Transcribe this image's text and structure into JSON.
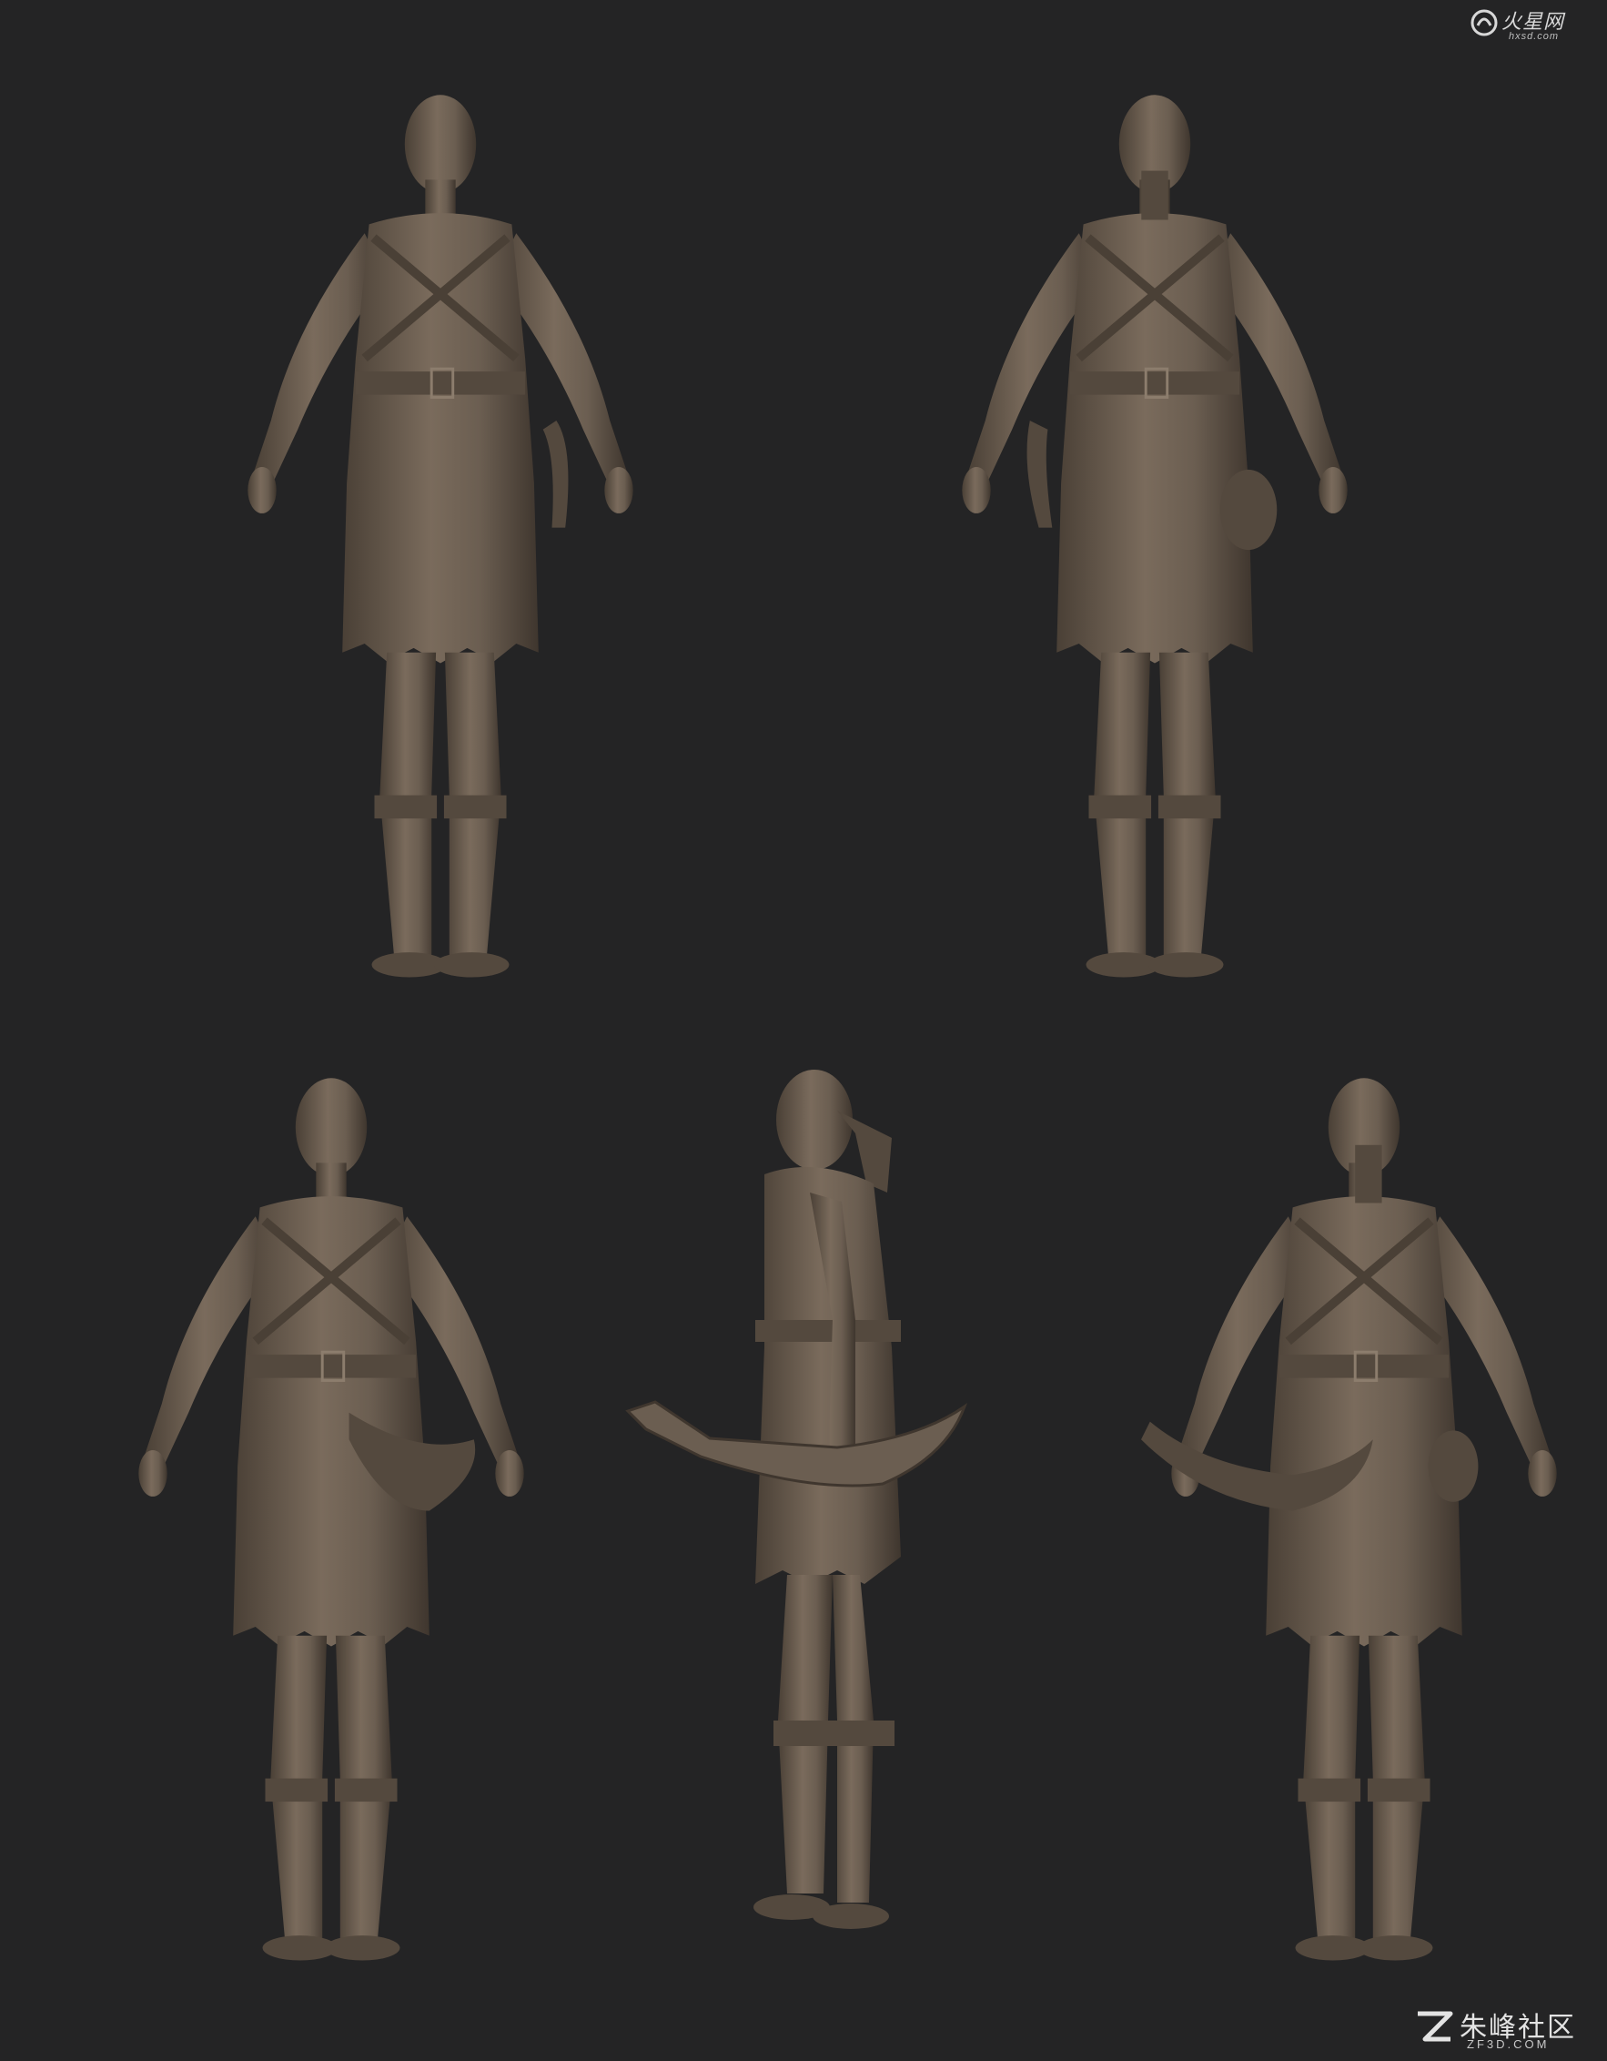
{
  "scene": {
    "background": "#242425",
    "sculpt_color": "#6b5e51",
    "sculpt_highlight": "#8c7d6d",
    "sculpt_shadow": "#3f362e",
    "views": [
      {
        "name": "front view",
        "icon": "figure-front"
      },
      {
        "name": "back view",
        "icon": "figure-back"
      },
      {
        "name": "three-quarter front view",
        "icon": "figure-three-quarter"
      },
      {
        "name": "side profile view",
        "icon": "figure-profile"
      },
      {
        "name": "three-quarter back view",
        "icon": "figure-back-three-quarter"
      }
    ]
  },
  "watermark_top": {
    "brand_cn": "火星网",
    "url": "hxsd.com"
  },
  "watermark_bottom": {
    "brand_cn": "朱峰社区",
    "url": "ZF3D.COM"
  }
}
